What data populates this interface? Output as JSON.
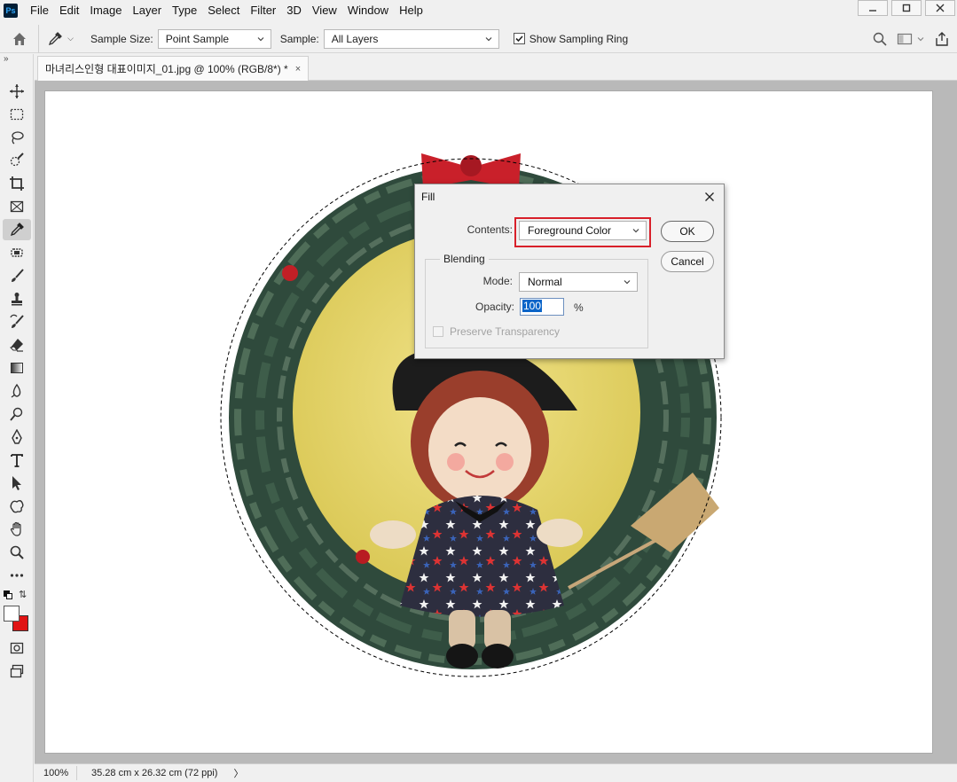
{
  "app": {
    "logo_text": "Ps",
    "menu": [
      "File",
      "Edit",
      "Image",
      "Layer",
      "Type",
      "Select",
      "Filter",
      "3D",
      "View",
      "Window",
      "Help"
    ]
  },
  "options": {
    "sample_size_label": "Sample Size:",
    "sample_size_value": "Point Sample",
    "sample_label": "Sample:",
    "sample_value": "All Layers",
    "show_ring_label": "Show Sampling Ring",
    "show_ring_checked": true
  },
  "document": {
    "tab_title": "마녀리스인형 대표이미지_01.jpg @ 100% (RGB/8*) *",
    "close_glyph": "×"
  },
  "status": {
    "zoom": "100%",
    "info": "35.28 cm x 26.32 cm (72 ppi)",
    "arrow": "〉"
  },
  "tools": [
    "move-tool-icon",
    "marquee-tool-icon",
    "lasso-tool-icon",
    "quick-select-tool-icon",
    "crop-tool-icon",
    "frame-tool-icon",
    "eyedropper-tool-icon",
    "spot-heal-tool-icon",
    "brush-tool-icon",
    "stamp-tool-icon",
    "history-brush-tool-icon",
    "eraser-tool-icon",
    "gradient-tool-icon",
    "blur-tool-icon",
    "dodge-tool-icon",
    "pen-tool-icon",
    "type-tool-icon",
    "path-select-tool-icon",
    "shape-tool-icon",
    "hand-tool-icon",
    "zoom-tool-icon",
    "more-tools-icon"
  ],
  "colors": {
    "foreground": "#ffffff",
    "background": "#e01414",
    "highlight": "#d8202a",
    "selection": "#0a64c8"
  },
  "dialog": {
    "title": "Fill",
    "contents_label": "Contents:",
    "contents_value": "Foreground Color",
    "blending_legend": "Blending",
    "mode_label": "Mode:",
    "mode_value": "Normal",
    "opacity_label": "Opacity:",
    "opacity_value": "100",
    "opacity_unit": "%",
    "preserve_label": "Preserve Transparency",
    "preserve_enabled": false,
    "ok_label": "OK",
    "cancel_label": "Cancel"
  }
}
